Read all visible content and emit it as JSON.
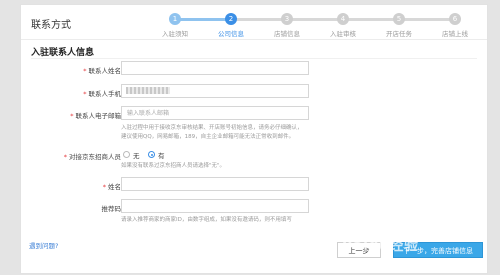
{
  "page_title": "联系方式",
  "steps": [
    {
      "label": "入驻须知",
      "number": "1",
      "state": "done"
    },
    {
      "label": "公司信息",
      "number": "2",
      "state": "active"
    },
    {
      "label": "店铺信息",
      "number": "3",
      "state": "todo"
    },
    {
      "label": "入驻审核",
      "number": "4",
      "state": "todo"
    },
    {
      "label": "开店任务",
      "number": "5",
      "state": "todo"
    },
    {
      "label": "店铺上线",
      "number": "6",
      "state": "todo"
    }
  ],
  "section_title": "入驻联系人信息",
  "form": {
    "name_label": "联系人姓名",
    "name_value": "",
    "phone_label": "联系人手机",
    "phone_value": "",
    "email_label": "联系人电子邮箱",
    "email_placeholder": "输入联系人邮箱",
    "email_hint_1": "入驻过程中用于接收京东审核结果、开店账号初始信息，请务必仔细确认，",
    "email_hint_2": "建议使用QQ，网易邮箱，189，自主企业邮箱可能无法正常收到邮件。",
    "recommender_label": "对接京东招商人员",
    "radio_no": "无",
    "radio_yes": "有",
    "recommender_hint": "如果没有联系过京东招商人员请选择\"无\"。",
    "contact_name_label": "姓名",
    "contact_name_value": "",
    "recommend_code_label": "推荐码",
    "recommend_code_value": "",
    "recommend_code_hint": "请录入推荐商家的商家ID，由数字组成，如果没有邀请码，则不用填写",
    "required_mark": "*"
  },
  "help_link": "遇到问题?",
  "buttons": {
    "prev": "上一步",
    "next": "下一步，完善店铺信息"
  },
  "watermark": "Baidu经验",
  "colors": {
    "accent": "#3aa7e8",
    "step_active": "#3b8fe6",
    "step_done": "#8fc3ef",
    "step_todo": "#cfcfcf",
    "required": "#e4393c"
  }
}
